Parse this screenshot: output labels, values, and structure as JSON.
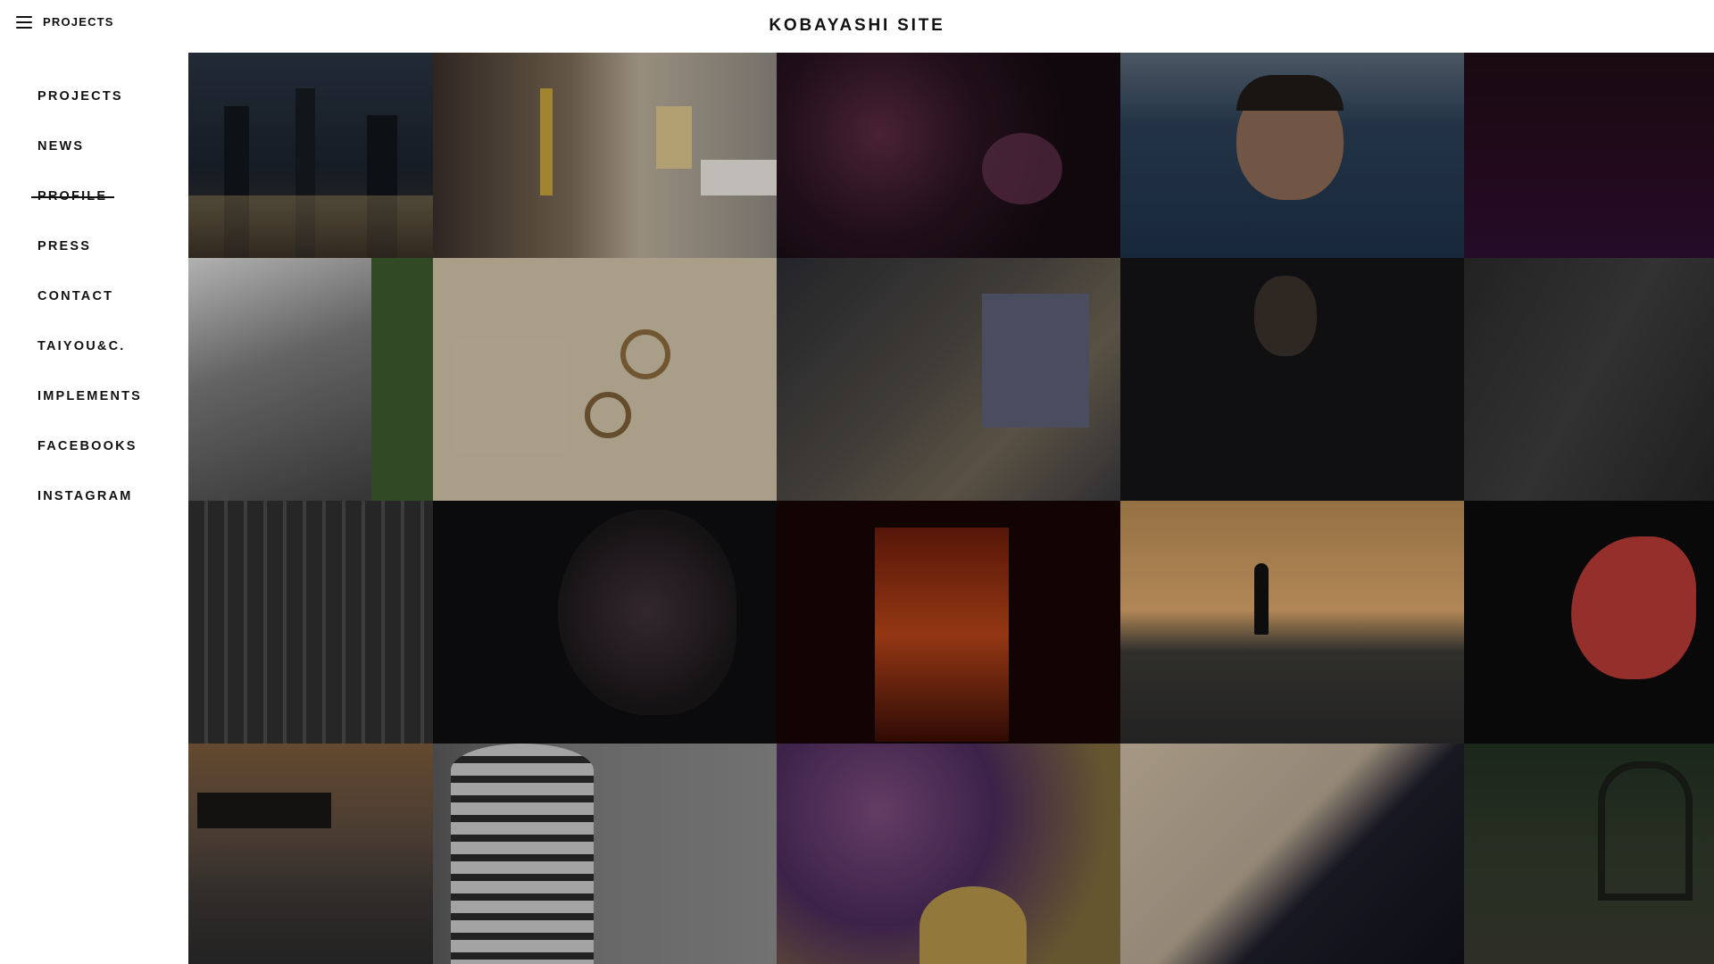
{
  "header": {
    "menu_label": "PROJECTS",
    "site_title": "KOBAYASHI SITE"
  },
  "sidebar": {
    "items": [
      {
        "label": "PROJECTS"
      },
      {
        "label": "NEWS"
      },
      {
        "label": "PROFILE",
        "state": "struck-through"
      },
      {
        "label": "PRESS"
      },
      {
        "label": "CONTACT"
      },
      {
        "label": "TAIYOU&C."
      },
      {
        "label": "IMPLEMENTS"
      },
      {
        "label": "FACEBOOKS"
      },
      {
        "label": "INSTAGRAM"
      }
    ]
  },
  "gallery": {
    "tiles": [
      {
        "subject": "night city skyline"
      },
      {
        "subject": "street with signs"
      },
      {
        "subject": "dark flowers"
      },
      {
        "subject": "face in water"
      },
      {
        "subject": "purple gradient"
      },
      {
        "subject": "architecture with green wall"
      },
      {
        "subject": "rings on stone"
      },
      {
        "subject": "city crossing from above"
      },
      {
        "subject": "portrait in dark"
      },
      {
        "subject": "dark abstract"
      },
      {
        "subject": "building facade lines"
      },
      {
        "subject": "mesh sculpture"
      },
      {
        "subject": "torii gates"
      },
      {
        "subject": "silhouette at sunset"
      },
      {
        "subject": "red flamingo"
      },
      {
        "subject": "pier at sunset"
      },
      {
        "subject": "round tower building"
      },
      {
        "subject": "purple and yellow field"
      },
      {
        "subject": "folded paper"
      },
      {
        "subject": "plants and chairs"
      }
    ]
  }
}
